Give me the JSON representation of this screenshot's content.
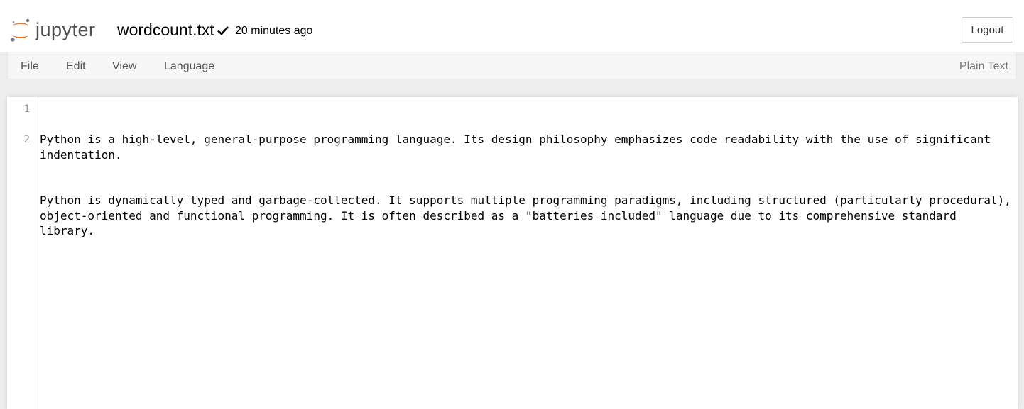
{
  "header": {
    "logo_text": "jupyter",
    "doc_title": "wordcount.txt",
    "last_saved": "20 minutes ago",
    "logout_label": "Logout"
  },
  "menu": {
    "items": [
      {
        "label": "File"
      },
      {
        "label": "Edit"
      },
      {
        "label": "View"
      },
      {
        "label": "Language"
      }
    ],
    "mode": "Plain Text"
  },
  "editor": {
    "lines": [
      {
        "number": "1",
        "text": "Python is a high-level, general-purpose programming language. Its design philosophy emphasizes code readability with the use of significant indentation."
      },
      {
        "number": "2",
        "text": "Python is dynamically typed and garbage-collected. It supports multiple programming paradigms, including structured (particularly procedural), object-oriented and functional programming. It is often described as a \"batteries included\" language due to its comprehensive standard library."
      }
    ]
  },
  "colors": {
    "logo_orange": "#f37726",
    "logo_gray": "#767677",
    "menubar_bg": "#f7f7f7"
  },
  "icons": {
    "logo": "jupyter-logo-icon",
    "saved": "checkmark-icon"
  }
}
